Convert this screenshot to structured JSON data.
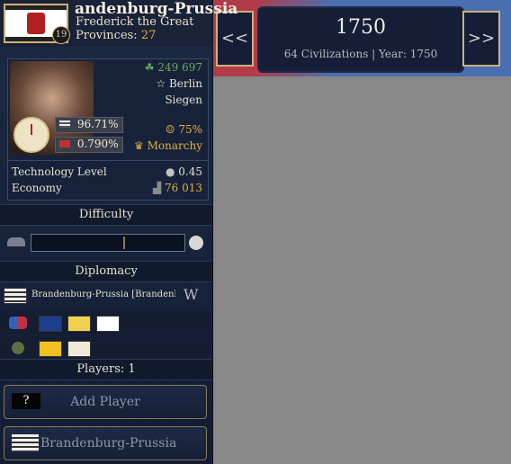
{
  "header": {
    "country_name": "andenburg-Prussia",
    "ruler": "Frederick the Great",
    "provinces_label": "Provinces:",
    "provinces_value": "27",
    "level": "19"
  },
  "stats": {
    "population": "249 697",
    "capital": "Berlin",
    "city2": "Siegen",
    "stability": "96.71%",
    "rate": "0.790%",
    "happiness": "75%",
    "government": "Monarchy",
    "tech_label": "Technology Level",
    "tech_value": "0.45",
    "economy_label": "Economy",
    "economy_value": "76 013"
  },
  "sections": {
    "difficulty": "Difficulty",
    "diplomacy": "Diplomacy",
    "players": "Players: 1"
  },
  "diplomacy": {
    "ally_name": "Brandenburg-Prussia [Brandenbu"
  },
  "buttons": {
    "add_player_icon": "?",
    "add_player": "Add Player",
    "player_country": "Brandenburg-Prussia"
  },
  "topcenter": {
    "year_big": "1750",
    "summary": "64 Civilizations | Year: 1750",
    "prev": "<<",
    "next": ">>"
  },
  "colors": {
    "gold": "#e0b040",
    "green": "#6ea85a",
    "panel": "#17223a"
  }
}
